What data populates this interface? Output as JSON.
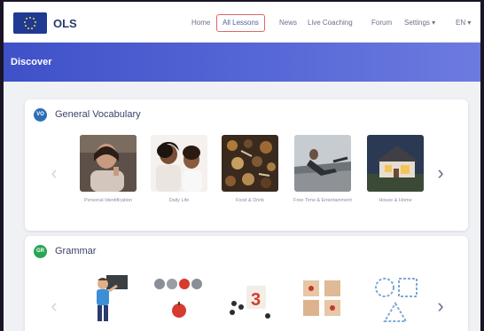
{
  "app": {
    "name": "OLS"
  },
  "nav": {
    "items": [
      {
        "label": "Home",
        "active": false
      },
      {
        "label": "All Lessons",
        "active": true
      },
      {
        "label": "News",
        "active": false
      },
      {
        "label": "Live Coaching",
        "active": false
      },
      {
        "label": "Forum",
        "active": false
      },
      {
        "label": "Settings ▾",
        "active": false
      },
      {
        "label": "EN ▾",
        "active": false
      }
    ]
  },
  "header": {
    "title": "Discover"
  },
  "sections": [
    {
      "badge": "VO",
      "title": "General Vocabulary",
      "icon": "category-circle-icon",
      "color": "#2c6fb7",
      "tiles": [
        {
          "label": "Personal Identification",
          "image": "woman-portrait"
        },
        {
          "label": "Daily Life",
          "image": "mother-child"
        },
        {
          "label": "Food & Drink",
          "image": "spices"
        },
        {
          "label": "Free Time & Entertainment",
          "image": "relaxing-outdoors"
        },
        {
          "label": "House & Home",
          "image": "house-exterior"
        }
      ]
    },
    {
      "badge": "GR",
      "title": "Grammar",
      "icon": "category-circle-icon",
      "color": "#2aa556",
      "tiles": [
        {
          "label": "",
          "image": "boy-with-chalkboard"
        },
        {
          "label": "",
          "image": "apples"
        },
        {
          "label": "",
          "image": "number-card"
        },
        {
          "label": "",
          "image": "letter-blocks"
        },
        {
          "label": "",
          "image": "shapes"
        }
      ]
    }
  ],
  "colors": {
    "accent": "#4a5ad0",
    "active_nav_border": "#e06470"
  }
}
